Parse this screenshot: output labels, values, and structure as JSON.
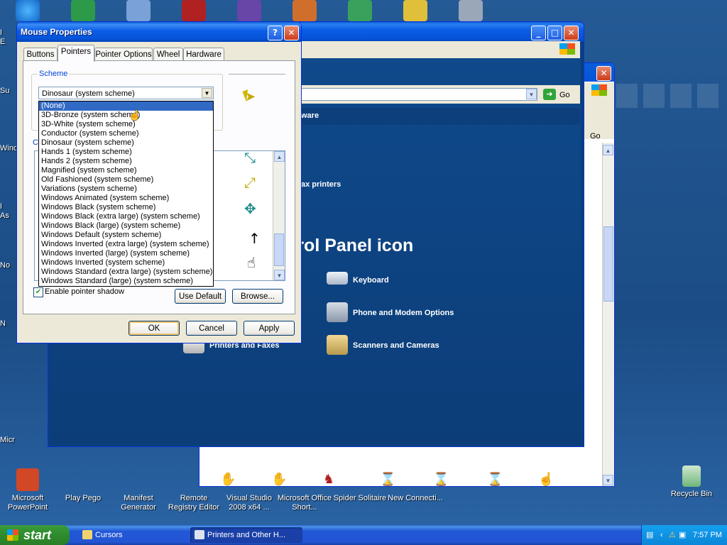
{
  "desktop": {
    "bottom_icons": [
      {
        "label": "Microsoft PowerPoint",
        "color": "#d24726"
      },
      {
        "label": "Play Pego",
        "color": "#3d6fb8"
      },
      {
        "label": "Manifest Generator",
        "color": "#6b8fc6"
      },
      {
        "label": "Remote Registry Editor",
        "color": "#3f7cc5"
      },
      {
        "label": "Visual Studio 2008 x64 ...",
        "color": "#6d3fa5"
      },
      {
        "label": "Microsoft Office Short...",
        "color": "#d86a2a"
      },
      {
        "label": "Spider Solitaire",
        "color": "#3c8c3c"
      },
      {
        "label": "New Connecti...",
        "color": "#2b6cb0"
      }
    ],
    "recycle_bin": {
      "label": "Recycle Bin"
    },
    "left_cut_labels": [
      "I",
      "E",
      "Su",
      "Wind",
      "I",
      "As",
      "No",
      "N",
      "Micr"
    ]
  },
  "control_panel": {
    "go_label": "Go",
    "banner": "ware",
    "fax_text": "ax printers",
    "big_title": "trol Panel icon",
    "items": [
      {
        "label": "Keyboard",
        "icon": "keyboard-icon"
      },
      {
        "label": "Phone and Modem Options",
        "icon": "phone-icon"
      },
      {
        "label": "Printers and Faxes",
        "icon": "printer-icon"
      },
      {
        "label": "Scanners and Cameras",
        "icon": "scanner-icon"
      }
    ]
  },
  "back_window": {
    "go_label": "Go",
    "cursor_files": [
      "help_l",
      "help_r",
      "help_rm",
      "hibeam",
      "hmove",
      "hnesw",
      "hnodrop"
    ]
  },
  "dialog": {
    "title": "Mouse Properties",
    "help_btn": "?",
    "close_btn": "✕",
    "tabs": [
      "Buttons",
      "Pointers",
      "Pointer Options",
      "Wheel",
      "Hardware"
    ],
    "active_tab": "Pointers",
    "scheme_label": "Scheme",
    "customize_label_cut": "C",
    "scheme_value": "Dinosaur (system scheme)",
    "scheme_options": [
      "(None)",
      "3D-Bronze (system scheme)",
      "3D-White (system scheme)",
      "Conductor (system scheme)",
      "Dinosaur (system scheme)",
      "Hands 1 (system scheme)",
      "Hands 2 (system scheme)",
      "Magnified (system scheme)",
      "Old Fashioned (system scheme)",
      "Variations (system scheme)",
      "Windows Animated (system scheme)",
      "Windows Black  (system scheme)",
      "Windows Black (extra large) (system scheme)",
      "Windows Black (large) (system scheme)",
      "Windows Default (system scheme)",
      "Windows Inverted (extra large) (system scheme)",
      "Windows Inverted (large) (system scheme)",
      "Windows Inverted (system scheme)",
      "Windows Standard (extra large) (system scheme)",
      "Windows Standard (large) (system scheme)"
    ],
    "highlighted_option": "(None)",
    "enable_shadow_label": "Enable pointer shadow",
    "use_default_label": "Use Default",
    "browse_label": "Browse...",
    "ok_label": "OK",
    "cancel_label": "Cancel",
    "apply_label": "Apply"
  },
  "taskbar": {
    "start_label": "start",
    "tasks": [
      "Cursors",
      "Printers and Other H..."
    ],
    "clock": "7:57 PM"
  },
  "colors": {
    "titlebar": "#0653d8",
    "selection": "#316ac5",
    "desktop": "#1d4f87"
  }
}
